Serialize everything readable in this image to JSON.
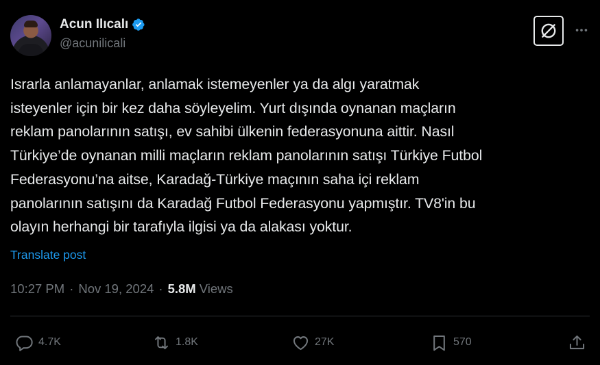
{
  "author": {
    "display_name": "Acun Ilıcalı",
    "handle": "@acunilicali",
    "verified": true
  },
  "tweet": {
    "text": "Israrla anlamayanlar, anlamak istemeyenler ya da algı yaratmak\nisteyenler için bir kez daha söyleyelim. Yurt dışında oynanan maçların\nreklam panolarının satışı, ev sahibi ülkenin federasyonuna aittir. Nasıl\nTürkiye’de oynanan milli maçların reklam panolarının satışı Türkiye Futbol\nFederasyonu’na aitse, Karadağ-Türkiye maçının saha içi reklam\npanolarının satışını da Karadağ Futbol Federasyonu yapmıştır. TV8'in bu\nolayın herhangi bir tarafıyla ilgisi ya da alakası yoktur.",
    "translate_label": "Translate post",
    "time": "10:27 PM",
    "separator": "·",
    "date": "Nov 19, 2024",
    "views_count": "5.8M",
    "views_label": "Views"
  },
  "actions": {
    "replies": "4.7K",
    "reposts": "1.8K",
    "likes": "27K",
    "bookmarks": "570"
  },
  "icons": {
    "verified": "verified-badge-icon",
    "grok": "grok-icon",
    "more": "more-icon",
    "reply": "reply-icon",
    "repost": "repost-icon",
    "like": "like-icon",
    "bookmark": "bookmark-icon",
    "share": "share-icon"
  },
  "colors": {
    "background": "#000000",
    "text": "#e7e9ea",
    "secondary": "#71767b",
    "accent": "#1d9bf0",
    "divider": "#2f3336"
  }
}
